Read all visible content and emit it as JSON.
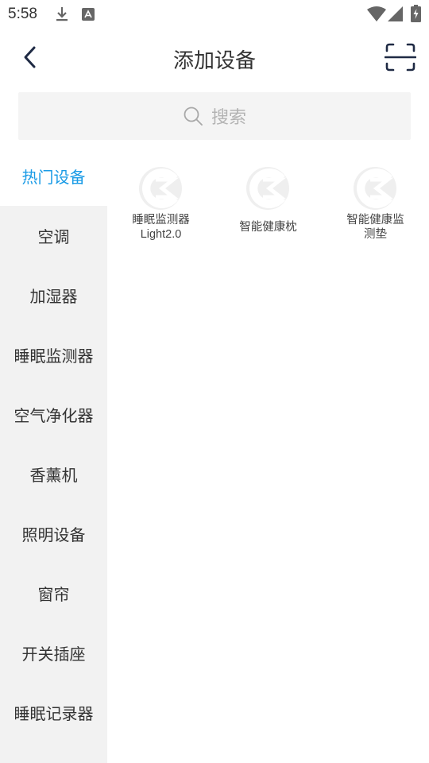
{
  "status_bar": {
    "time": "5:58"
  },
  "header": {
    "title": "添加设备"
  },
  "search": {
    "placeholder": "搜索"
  },
  "sidebar": {
    "items": [
      {
        "label": "热门设备",
        "active": true
      },
      {
        "label": "空调"
      },
      {
        "label": "加湿器"
      },
      {
        "label": "睡眠监测器"
      },
      {
        "label": "空气净化器"
      },
      {
        "label": "香薰机"
      },
      {
        "label": "照明设备"
      },
      {
        "label": "窗帘"
      },
      {
        "label": "开关插座"
      },
      {
        "label": "睡眠记录器"
      }
    ]
  },
  "devices": [
    {
      "name_line1": "睡眠监测器",
      "name_line2": "Light2.0"
    },
    {
      "name_line1": "智能健康枕",
      "name_line2": ""
    },
    {
      "name_line1": "智能健康监",
      "name_line2": "测垫"
    }
  ],
  "colors": {
    "accent": "#1a9be6",
    "sidebar_bg": "#f2f2f2",
    "search_bg": "#f4f4f4"
  }
}
